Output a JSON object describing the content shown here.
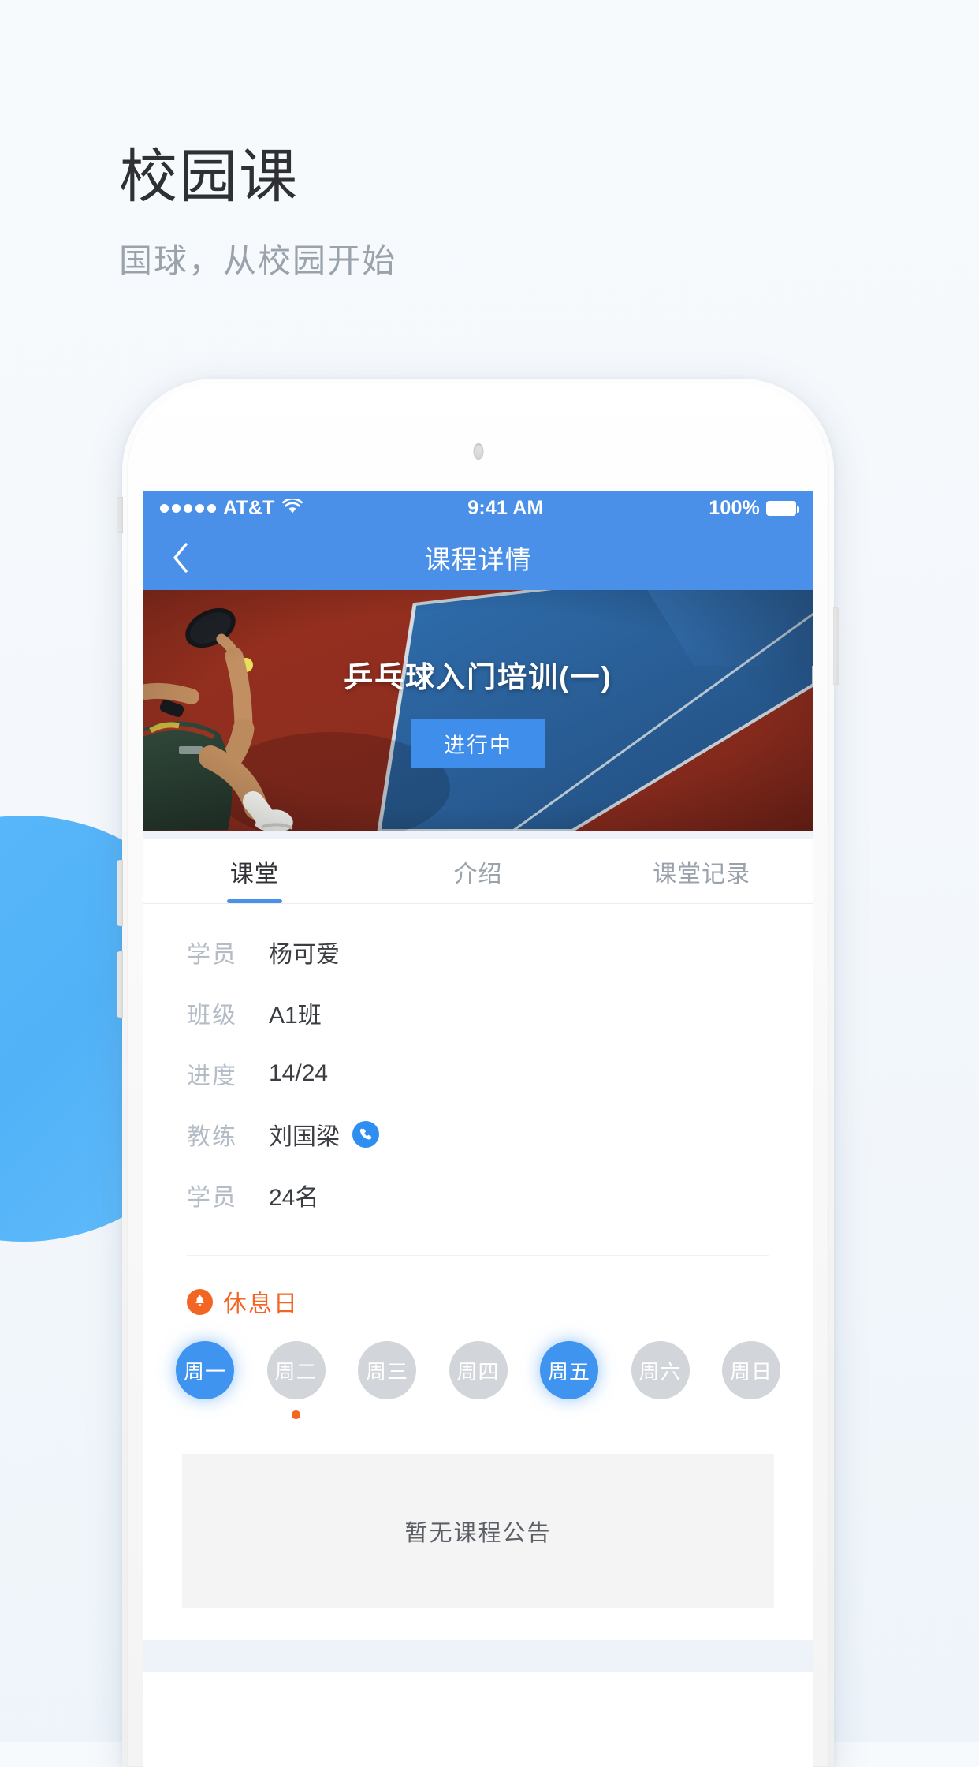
{
  "promo": {
    "title": "校园课",
    "subtitle": "国球，从校园开始"
  },
  "colors": {
    "brand_blue": "#4a90e8",
    "accent_orange": "#f26522",
    "chip_active": "#3f94f0",
    "chip_inactive": "#d2d5d9",
    "page_bg": "#f5f9fc"
  },
  "statusbar": {
    "carrier": "AT&T",
    "signal_dots": 5,
    "wifi_icon": "wifi-icon",
    "time": "9:41 AM",
    "battery_percent": "100%",
    "battery_icon": "battery-full-icon"
  },
  "navbar": {
    "back_icon": "chevron-left-icon",
    "title": "课程详情"
  },
  "hero": {
    "title": "乒乓球入门培训(一)",
    "badge": "进行中",
    "image_alt": "table-tennis-player-photo"
  },
  "tabs": [
    {
      "label": "课堂",
      "active": true
    },
    {
      "label": "介绍",
      "active": false
    },
    {
      "label": "课堂记录",
      "active": false
    }
  ],
  "info_rows": [
    {
      "label": "学员",
      "value": "杨可爱",
      "icon": null
    },
    {
      "label": "班级",
      "value": "A1班",
      "icon": null
    },
    {
      "label": "进度",
      "value": "14/24",
      "icon": null
    },
    {
      "label": "教练",
      "value": "刘国梁",
      "icon": "phone-call-icon"
    },
    {
      "label": "学员",
      "value": "24名",
      "icon": null
    }
  ],
  "rest_day": {
    "icon": "bell-icon",
    "label": "休息日"
  },
  "weekdays": [
    {
      "label": "周一",
      "active": true,
      "dot": false
    },
    {
      "label": "周二",
      "active": false,
      "dot": true
    },
    {
      "label": "周三",
      "active": false,
      "dot": false
    },
    {
      "label": "周四",
      "active": false,
      "dot": false
    },
    {
      "label": "周五",
      "active": true,
      "dot": false
    },
    {
      "label": "周六",
      "active": false,
      "dot": false
    },
    {
      "label": "周日",
      "active": false,
      "dot": false
    }
  ],
  "announcement": {
    "empty_text": "暂无课程公告"
  }
}
